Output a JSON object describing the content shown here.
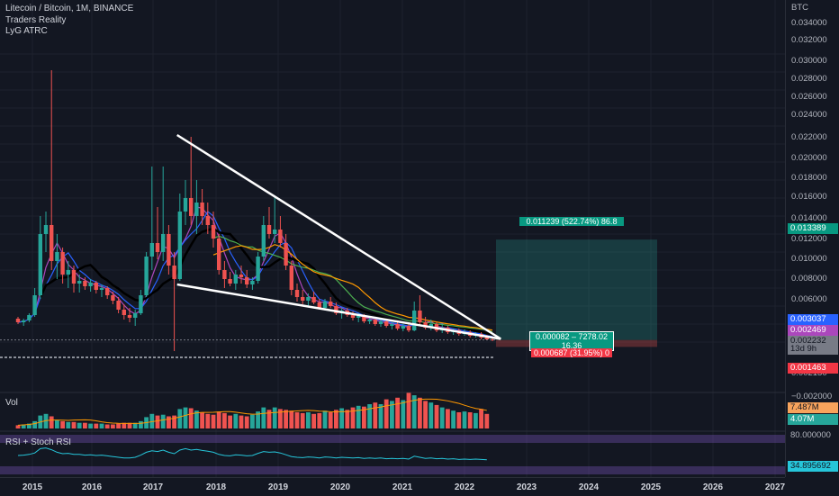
{
  "header": {
    "title": "Litecoin / Bitcoin, 1M, BINANCE",
    "indicators": [
      "Traders Reality",
      "LyG ATRC"
    ]
  },
  "price_axis": {
    "currency": "BTC",
    "ticks": [
      "0.034000",
      "0.032000",
      "0.030000",
      "0.028000",
      "0.026000",
      "0.024000",
      "0.022000",
      "0.020000",
      "0.018000",
      "0.016000",
      "0.014000",
      "0.012000",
      "0.010000",
      "0.008000",
      "0.006000",
      "0.004000",
      "0.002150",
      "−0.002000"
    ],
    "badges": {
      "target": "0.013389",
      "ma_blue": "0.003037",
      "ma_purple": "0.002469",
      "last_price": "0.002232",
      "countdown": "13d 9h",
      "stop": "0.001463"
    }
  },
  "position_tool": {
    "target_label": "0.011239 (522.74%) 86.8",
    "center_line1": "0.000082 – 7278.02",
    "center_line2": "16.36",
    "stop_label": "0.000687 (31.95%) 0"
  },
  "volume_pane": {
    "label": "Vol",
    "badge_top": "7.487M",
    "badge_bottom": "4.07M"
  },
  "rsi_pane": {
    "label": "RSI + Stoch RSI",
    "badge_top": "80.000000",
    "badge_value": "34.895692"
  },
  "time_axis": {
    "years": [
      "2015",
      "2016",
      "2017",
      "2018",
      "2019",
      "2020",
      "2021",
      "2022",
      "2023",
      "2024",
      "2025",
      "2026",
      "2027"
    ]
  },
  "colors": {
    "background": "#131722",
    "up": "#26a69a",
    "down": "#ef5350",
    "ma_black": "#000000",
    "ma_blue": "#2962ff",
    "ma_purple": "#ab47bc",
    "ma_green": "#4caf50",
    "ma_orange": "#ff9800",
    "rsi_line": "#26c6da",
    "rsi_band": "#7e57c2"
  },
  "chart_data": {
    "type": "candlestick",
    "symbol": "LTC/BTC",
    "interval": "1M",
    "exchange": "BINANCE",
    "y_range": [
      -0.002,
      0.035
    ],
    "candles": [
      {
        "o": 0.0046,
        "h": 0.0048,
        "l": 0.004,
        "c": 0.0042
      },
      {
        "o": 0.0042,
        "h": 0.0046,
        "l": 0.0038,
        "c": 0.0044
      },
      {
        "o": 0.0044,
        "h": 0.0052,
        "l": 0.0042,
        "c": 0.005
      },
      {
        "o": 0.005,
        "h": 0.008,
        "l": 0.0048,
        "c": 0.0072
      },
      {
        "o": 0.0072,
        "h": 0.016,
        "l": 0.0068,
        "c": 0.014
      },
      {
        "o": 0.014,
        "h": 0.0165,
        "l": 0.012,
        "c": 0.015
      },
      {
        "o": 0.015,
        "h": 0.0322,
        "l": 0.01,
        "c": 0.011
      },
      {
        "o": 0.011,
        "h": 0.014,
        "l": 0.009,
        "c": 0.012
      },
      {
        "o": 0.012,
        "h": 0.0125,
        "l": 0.0085,
        "c": 0.0095
      },
      {
        "o": 0.0095,
        "h": 0.011,
        "l": 0.008,
        "c": 0.01
      },
      {
        "o": 0.01,
        "h": 0.0105,
        "l": 0.0075,
        "c": 0.0085
      },
      {
        "o": 0.0085,
        "h": 0.0095,
        "l": 0.0075,
        "c": 0.0088
      },
      {
        "o": 0.0088,
        "h": 0.0092,
        "l": 0.0078,
        "c": 0.0082
      },
      {
        "o": 0.0082,
        "h": 0.009,
        "l": 0.0076,
        "c": 0.0086
      },
      {
        "o": 0.0086,
        "h": 0.0088,
        "l": 0.0074,
        "c": 0.0078
      },
      {
        "o": 0.0078,
        "h": 0.0084,
        "l": 0.007,
        "c": 0.008
      },
      {
        "o": 0.008,
        "h": 0.0082,
        "l": 0.0068,
        "c": 0.0072
      },
      {
        "o": 0.0072,
        "h": 0.0076,
        "l": 0.0062,
        "c": 0.0066
      },
      {
        "o": 0.0066,
        "h": 0.007,
        "l": 0.0052,
        "c": 0.0056
      },
      {
        "o": 0.0056,
        "h": 0.0062,
        "l": 0.0045,
        "c": 0.005
      },
      {
        "o": 0.005,
        "h": 0.0058,
        "l": 0.0042,
        "c": 0.0047
      },
      {
        "o": 0.0047,
        "h": 0.0056,
        "l": 0.0038,
        "c": 0.0052
      },
      {
        "o": 0.0052,
        "h": 0.0078,
        "l": 0.005,
        "c": 0.0072
      },
      {
        "o": 0.0072,
        "h": 0.012,
        "l": 0.007,
        "c": 0.0115
      },
      {
        "o": 0.0115,
        "h": 0.0215,
        "l": 0.01,
        "c": 0.013
      },
      {
        "o": 0.013,
        "h": 0.017,
        "l": 0.0112,
        "c": 0.012
      },
      {
        "o": 0.012,
        "h": 0.0215,
        "l": 0.011,
        "c": 0.014
      },
      {
        "o": 0.014,
        "h": 0.015,
        "l": 0.0095,
        "c": 0.0105
      },
      {
        "o": 0.0105,
        "h": 0.012,
        "l": 0.001,
        "c": 0.009
      },
      {
        "o": 0.009,
        "h": 0.0185,
        "l": 0.0088,
        "c": 0.0165
      },
      {
        "o": 0.0165,
        "h": 0.02,
        "l": 0.015,
        "c": 0.018
      },
      {
        "o": 0.018,
        "h": 0.0248,
        "l": 0.015,
        "c": 0.016
      },
      {
        "o": 0.016,
        "h": 0.02,
        "l": 0.014,
        "c": 0.0175
      },
      {
        "o": 0.0175,
        "h": 0.019,
        "l": 0.015,
        "c": 0.016
      },
      {
        "o": 0.016,
        "h": 0.0175,
        "l": 0.014,
        "c": 0.015
      },
      {
        "o": 0.015,
        "h": 0.0165,
        "l": 0.0125,
        "c": 0.0135
      },
      {
        "o": 0.0135,
        "h": 0.014,
        "l": 0.0095,
        "c": 0.01
      },
      {
        "o": 0.01,
        "h": 0.011,
        "l": 0.008,
        "c": 0.009
      },
      {
        "o": 0.009,
        "h": 0.0098,
        "l": 0.0082,
        "c": 0.0085
      },
      {
        "o": 0.0085,
        "h": 0.01,
        "l": 0.0078,
        "c": 0.0095
      },
      {
        "o": 0.0095,
        "h": 0.0105,
        "l": 0.0085,
        "c": 0.0092
      },
      {
        "o": 0.0092,
        "h": 0.01,
        "l": 0.008,
        "c": 0.0084
      },
      {
        "o": 0.0084,
        "h": 0.0092,
        "l": 0.0078,
        "c": 0.0088
      },
      {
        "o": 0.0088,
        "h": 0.012,
        "l": 0.0085,
        "c": 0.0115
      },
      {
        "o": 0.0115,
        "h": 0.016,
        "l": 0.011,
        "c": 0.015
      },
      {
        "o": 0.015,
        "h": 0.017,
        "l": 0.0135,
        "c": 0.014
      },
      {
        "o": 0.014,
        "h": 0.0182,
        "l": 0.013,
        "c": 0.0145
      },
      {
        "o": 0.0145,
        "h": 0.016,
        "l": 0.0125,
        "c": 0.013
      },
      {
        "o": 0.013,
        "h": 0.014,
        "l": 0.01,
        "c": 0.0105
      },
      {
        "o": 0.0105,
        "h": 0.011,
        "l": 0.0072,
        "c": 0.0078
      },
      {
        "o": 0.0078,
        "h": 0.0085,
        "l": 0.0065,
        "c": 0.007
      },
      {
        "o": 0.007,
        "h": 0.0078,
        "l": 0.0062,
        "c": 0.0066
      },
      {
        "o": 0.0066,
        "h": 0.0074,
        "l": 0.006,
        "c": 0.007
      },
      {
        "o": 0.007,
        "h": 0.0076,
        "l": 0.0062,
        "c": 0.0064
      },
      {
        "o": 0.0064,
        "h": 0.0068,
        "l": 0.0056,
        "c": 0.0058
      },
      {
        "o": 0.0058,
        "h": 0.0068,
        "l": 0.0055,
        "c": 0.0065
      },
      {
        "o": 0.0065,
        "h": 0.007,
        "l": 0.0058,
        "c": 0.006
      },
      {
        "o": 0.006,
        "h": 0.0064,
        "l": 0.005,
        "c": 0.0052
      },
      {
        "o": 0.0052,
        "h": 0.0058,
        "l": 0.0046,
        "c": 0.0055
      },
      {
        "o": 0.0055,
        "h": 0.0058,
        "l": 0.0048,
        "c": 0.005
      },
      {
        "o": 0.005,
        "h": 0.0054,
        "l": 0.0044,
        "c": 0.0047
      },
      {
        "o": 0.0047,
        "h": 0.0052,
        "l": 0.0042,
        "c": 0.0049
      },
      {
        "o": 0.0049,
        "h": 0.0051,
        "l": 0.0041,
        "c": 0.0043
      },
      {
        "o": 0.0043,
        "h": 0.0048,
        "l": 0.004,
        "c": 0.0045
      },
      {
        "o": 0.0045,
        "h": 0.0047,
        "l": 0.0038,
        "c": 0.004
      },
      {
        "o": 0.004,
        "h": 0.0045,
        "l": 0.0037,
        "c": 0.0043
      },
      {
        "o": 0.0043,
        "h": 0.0045,
        "l": 0.0036,
        "c": 0.0038
      },
      {
        "o": 0.0038,
        "h": 0.0042,
        "l": 0.0034,
        "c": 0.004
      },
      {
        "o": 0.004,
        "h": 0.0042,
        "l": 0.0033,
        "c": 0.0035
      },
      {
        "o": 0.0035,
        "h": 0.004,
        "l": 0.0032,
        "c": 0.0038
      },
      {
        "o": 0.0038,
        "h": 0.004,
        "l": 0.0031,
        "c": 0.0033
      },
      {
        "o": 0.0033,
        "h": 0.0065,
        "l": 0.0032,
        "c": 0.0055
      },
      {
        "o": 0.0055,
        "h": 0.0072,
        "l": 0.004,
        "c": 0.0042
      },
      {
        "o": 0.0042,
        "h": 0.0048,
        "l": 0.0034,
        "c": 0.0036
      },
      {
        "o": 0.0036,
        "h": 0.0045,
        "l": 0.0033,
        "c": 0.004
      },
      {
        "o": 0.004,
        "h": 0.0042,
        "l": 0.0031,
        "c": 0.0033
      },
      {
        "o": 0.0033,
        "h": 0.004,
        "l": 0.003,
        "c": 0.0036
      },
      {
        "o": 0.0036,
        "h": 0.0038,
        "l": 0.0029,
        "c": 0.0031
      },
      {
        "o": 0.0031,
        "h": 0.0035,
        "l": 0.0028,
        "c": 0.0033
      },
      {
        "o": 0.0033,
        "h": 0.0035,
        "l": 0.0027,
        "c": 0.0029
      },
      {
        "o": 0.0029,
        "h": 0.0034,
        "l": 0.0027,
        "c": 0.0031
      },
      {
        "o": 0.0031,
        "h": 0.0033,
        "l": 0.0025,
        "c": 0.0027
      },
      {
        "o": 0.0027,
        "h": 0.0031,
        "l": 0.0025,
        "c": 0.0029
      },
      {
        "o": 0.0029,
        "h": 0.0031,
        "l": 0.0023,
        "c": 0.0025
      },
      {
        "o": 0.0025,
        "h": 0.0028,
        "l": 0.0022,
        "c": 0.0023
      },
      {
        "o": 0.0023,
        "h": 0.0026,
        "l": 0.0021,
        "c": 0.00223
      }
    ],
    "volume": [
      0.4,
      0.5,
      0.6,
      0.9,
      1.6,
      1.8,
      1.5,
      1.0,
      0.9,
      0.8,
      0.8,
      0.7,
      0.7,
      0.6,
      0.6,
      0.6,
      0.5,
      0.5,
      0.6,
      0.7,
      0.7,
      0.7,
      0.9,
      1.4,
      1.8,
      1.6,
      1.7,
      1.5,
      1.6,
      2.4,
      2.6,
      2.5,
      2.2,
      2.0,
      1.8,
      1.7,
      2.1,
      1.9,
      1.6,
      1.8,
      1.6,
      1.5,
      1.7,
      2.1,
      2.6,
      2.3,
      2.6,
      2.4,
      2.3,
      2.2,
      2.0,
      1.9,
      2.0,
      1.8,
      1.9,
      2.2,
      2.0,
      2.3,
      2.5,
      2.3,
      2.6,
      2.8,
      2.7,
      3.0,
      3.2,
      3.0,
      3.6,
      3.4,
      3.8,
      3.5,
      4.4,
      4.1,
      3.8,
      3.4,
      3.2,
      2.9,
      2.6,
      2.4,
      2.2,
      2.0,
      2.1,
      2.0,
      1.9,
      2.4,
      1.8
    ],
    "rsi_stoch": [
      0.55,
      0.56,
      0.58,
      0.62,
      0.74,
      0.76,
      0.71,
      0.64,
      0.6,
      0.61,
      0.58,
      0.58,
      0.56,
      0.57,
      0.55,
      0.56,
      0.54,
      0.52,
      0.5,
      0.48,
      0.48,
      0.5,
      0.56,
      0.64,
      0.68,
      0.66,
      0.7,
      0.64,
      0.6,
      0.7,
      0.74,
      0.7,
      0.72,
      0.69,
      0.67,
      0.64,
      0.58,
      0.55,
      0.54,
      0.57,
      0.56,
      0.54,
      0.55,
      0.61,
      0.66,
      0.64,
      0.65,
      0.62,
      0.57,
      0.52,
      0.5,
      0.49,
      0.51,
      0.5,
      0.48,
      0.51,
      0.5,
      0.48,
      0.5,
      0.49,
      0.48,
      0.49,
      0.47,
      0.48,
      0.47,
      0.48,
      0.46,
      0.47,
      0.46,
      0.47,
      0.45,
      0.53,
      0.5,
      0.47,
      0.48,
      0.46,
      0.47,
      0.45,
      0.46,
      0.44,
      0.45,
      0.44,
      0.45,
      0.44,
      0.43
    ],
    "trendlines": [
      {
        "from": [
          28.5,
          0.025
        ],
        "to": [
          86.5,
          0.00235
        ]
      },
      {
        "from": [
          28.5,
          0.0084
        ],
        "to": [
          86.5,
          0.00235
        ]
      }
    ],
    "position": {
      "entry": 0.002232,
      "target": 0.013389,
      "stop": 0.001463
    }
  }
}
